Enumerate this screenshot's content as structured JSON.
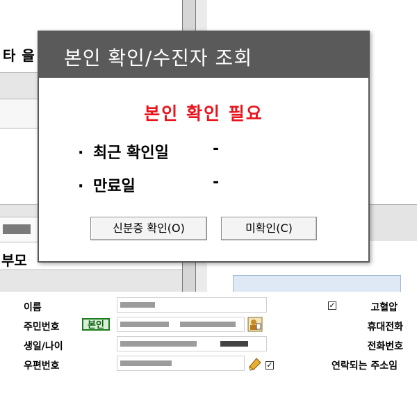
{
  "background": {
    "fragment_label_top": "타 을",
    "fragment_label_mid": "부모"
  },
  "dialog": {
    "title": "본인 확인/수진자 조회",
    "status": "본인 확인 필요",
    "recent_label": "최근 확인일",
    "recent_value": "-",
    "expire_label": "만료일",
    "expire_value": "-",
    "bullet": "·",
    "btn_verify": "신분증 확인(O)",
    "btn_unverified": "미확인(C)",
    "status_color": "#e8131b"
  },
  "form": {
    "name_label": "이름",
    "ssn_label": "주민번호",
    "self_badge": "본인",
    "birth_label": "생일/나이",
    "zip_label": "우편번호",
    "hypertension_label": "고혈압",
    "mobile_label": "휴대전화",
    "phone_label": "전화번호",
    "contact_address_label": "연락되는 주소임",
    "hypertension_checked": "✓",
    "contact_checked": "✓"
  }
}
